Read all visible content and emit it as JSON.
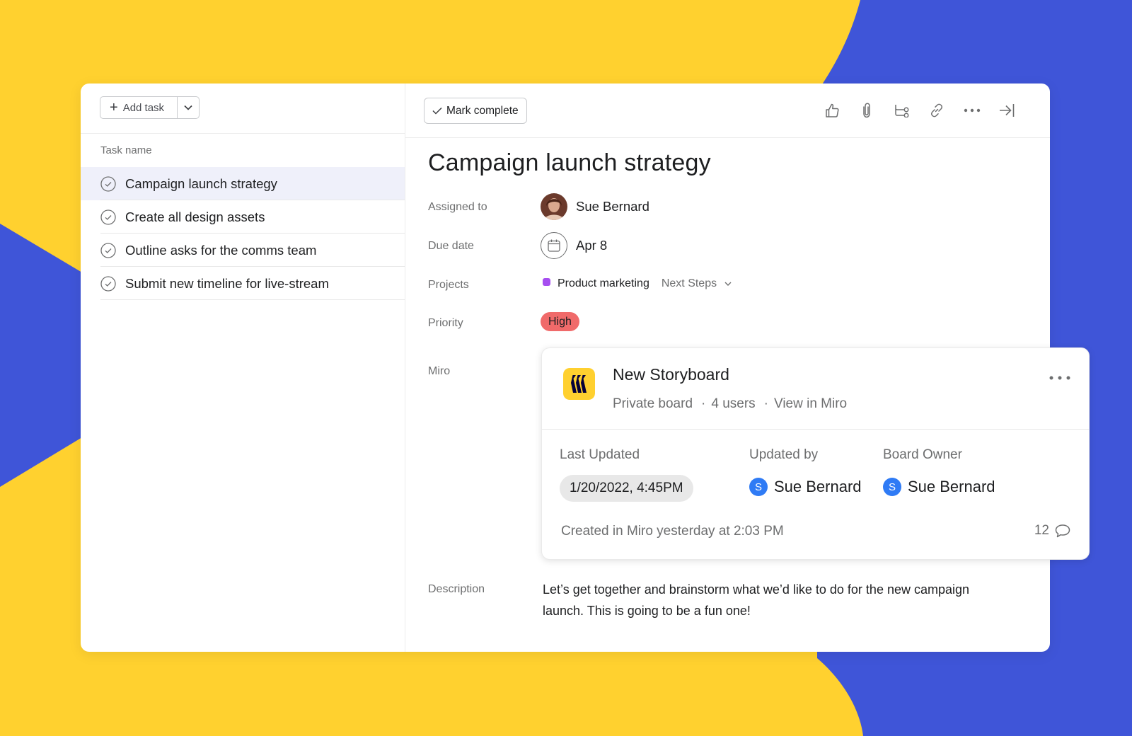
{
  "colors": {
    "background_yellow": "#ffd12f",
    "background_blue": "#3f55d8",
    "selected_row": "#eff0fa",
    "priority_high": "#f06a6a",
    "project_dot": "#a64ef0",
    "miro_yellow": "#ffd02f",
    "miro_mark": "#050038",
    "user_badge": "#2f7bf5"
  },
  "task_list": {
    "add_task_label": "Add task",
    "column_header": "Task name",
    "tasks": [
      {
        "name": "Campaign launch strategy",
        "selected": true
      },
      {
        "name": "Create all design assets",
        "selected": false
      },
      {
        "name": "Outline asks for the comms team",
        "selected": false
      },
      {
        "name": "Submit new timeline for live-stream",
        "selected": false
      }
    ]
  },
  "toolbar": {
    "mark_complete_label": "Mark complete",
    "icons": [
      "thumbs-up-icon",
      "paperclip-icon",
      "subtask-icon",
      "link-icon",
      "more-icon",
      "close-pane-icon"
    ]
  },
  "task": {
    "title": "Campaign launch strategy",
    "fields": {
      "assigned_label": "Assigned to",
      "assignee": "Sue Bernard",
      "due_label": "Due date",
      "due_date": "Apr 8",
      "projects_label": "Projects",
      "project_name": "Product marketing",
      "project_section": "Next Steps",
      "priority_label": "Priority",
      "priority": "High",
      "miro_label": "Miro",
      "description_label": "Description",
      "description": "Let’s get together and brainstorm what we’d like to do for the new campaign launch. This is going to be a fun one!"
    }
  },
  "miro": {
    "board_title": "New Storyboard",
    "visibility": "Private board",
    "users": "4 users",
    "view_link": "View in Miro",
    "last_updated_label": "Last Updated",
    "last_updated": "1/20/2022, 4:45PM",
    "updated_by_label": "Updated by",
    "updated_by_initial": "S",
    "updated_by": "Sue Bernard",
    "owner_label": "Board Owner",
    "owner_initial": "S",
    "owner": "Sue Bernard",
    "created": "Created in Miro yesterday at 2:03 PM",
    "comment_count": "12"
  }
}
